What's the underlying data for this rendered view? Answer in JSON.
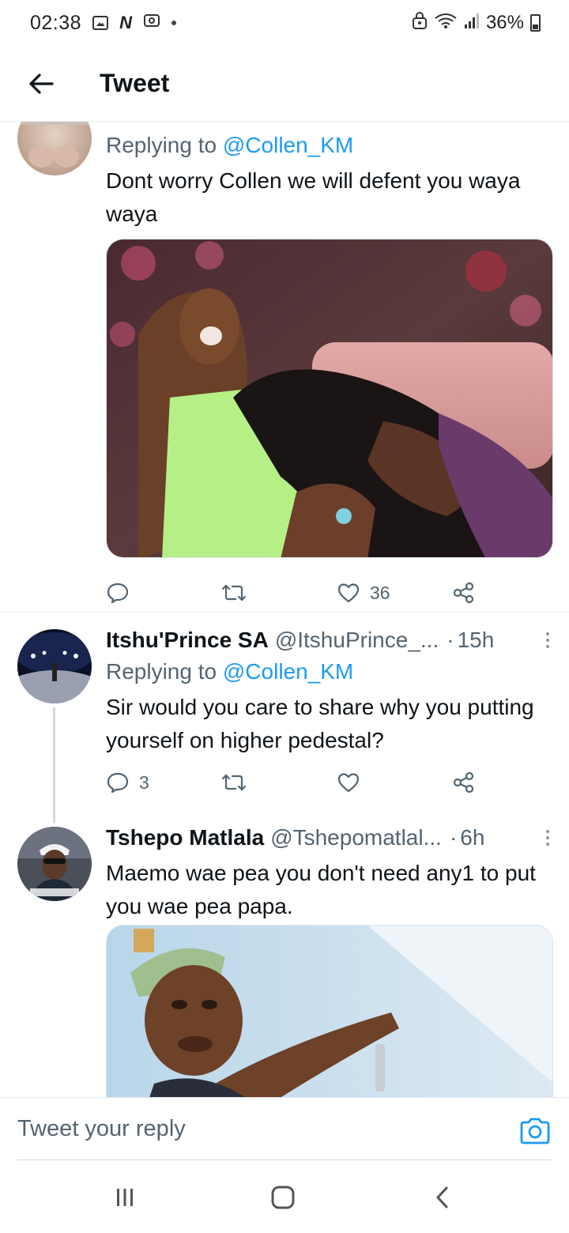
{
  "status_bar": {
    "time": "02:38",
    "battery": "36%",
    "left_icons": [
      "gallery-icon",
      "n-app-icon",
      "screen-record-icon",
      "notification-dot"
    ],
    "right_icons": [
      "lock-icon",
      "wifi-icon",
      "signal-icon",
      "battery-icon"
    ]
  },
  "header": {
    "title": "Tweet"
  },
  "tweets": [
    {
      "replying_prefix": "Replying to",
      "replying_to": "@Collen_KM",
      "text": "Dont worry Collen we will defent you waya waya",
      "has_media": true,
      "actions": {
        "replies": "",
        "retweets": "",
        "likes": "36"
      }
    },
    {
      "name": "Itshu'Prince SA",
      "handle": "@ItshuPrince_...",
      "time": "15h",
      "replying_prefix": "Replying to",
      "replying_to": "@Collen_KM",
      "text": "Sir would you care to share why you putting yourself on higher pedestal?",
      "actions": {
        "replies": "3",
        "retweets": "",
        "likes": ""
      }
    },
    {
      "name": "Tshepo Matlala",
      "handle": "@Tshepomatlal...",
      "time": "6h",
      "text": "Maemo wae pea you don't need any1 to put you wae pea papa.",
      "has_media": true
    }
  ],
  "reply_bar": {
    "placeholder": "Tweet your reply"
  },
  "colors": {
    "accent": "#1d9bf0",
    "secondary_text": "#536471",
    "divider": "#e6ecf0"
  }
}
